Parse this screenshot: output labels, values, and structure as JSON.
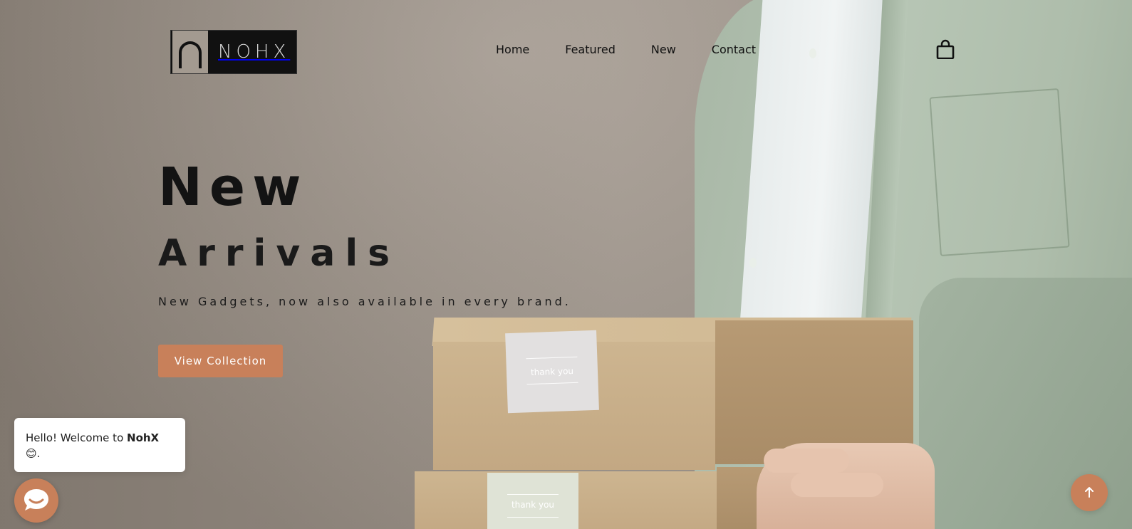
{
  "brand": {
    "logo_text": "NOHX"
  },
  "nav": {
    "items": [
      {
        "label": "Home"
      },
      {
        "label": "Featured"
      },
      {
        "label": "New"
      },
      {
        "label": "Contact"
      }
    ],
    "cart_icon": "shopping-bag-icon"
  },
  "hero": {
    "title": "New",
    "subtitle": "Arrivals",
    "tagline": "New Gadgets, now also available in every brand.",
    "cta_label": "View Collection",
    "box_label_1": "thank you",
    "box_label_2": "thank you"
  },
  "chat": {
    "greeting_prefix": "Hello! Welcome to ",
    "greeting_brand": "NohX",
    "greeting_suffix": "😊.",
    "launcher_icon": "chat-icon"
  },
  "scroll_top": {
    "icon": "arrow-up-icon"
  },
  "colors": {
    "accent": "#c8805a",
    "text_dark": "#131313",
    "logo_bg": "#111111"
  }
}
